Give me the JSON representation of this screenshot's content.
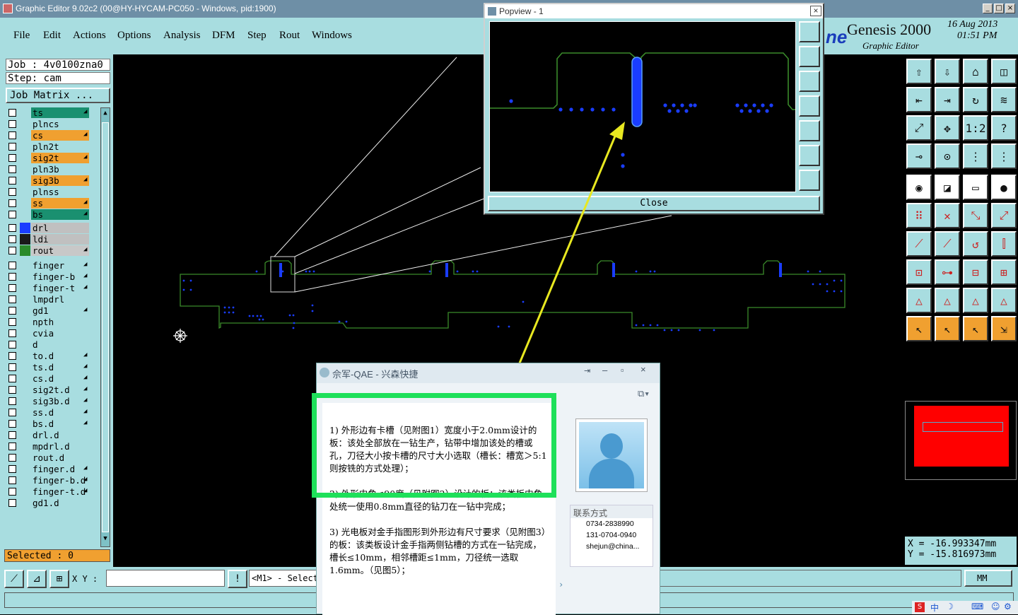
{
  "window": {
    "title": "Graphic Editor 9.02c2 (00@HY-HYCAM-PC050 - Windows, pid:1900)"
  },
  "menu": [
    "File",
    "Edit",
    "Actions",
    "Options",
    "Analysis",
    "DFM",
    "Step",
    "Rout",
    "Windows"
  ],
  "brand": {
    "name": "Genesis 2000",
    "subtitle": "Graphic Editor",
    "date": "16 Aug 2013",
    "time": "01:51 PM"
  },
  "job": {
    "job_label": "Job : 4v0100zna0",
    "step_label": "Step: cam",
    "matrix_button": "Job Matrix ..."
  },
  "layers": [
    {
      "name": "ts",
      "color": "#1a9070",
      "ext": true
    },
    {
      "name": "plncs",
      "color": "#a8dde0",
      "ext": false
    },
    {
      "name": "cs",
      "color": "#f0a030",
      "ext": true
    },
    {
      "name": "pln2t",
      "color": "#a8dde0",
      "ext": false
    },
    {
      "name": "sig2t",
      "color": "#f0a030",
      "ext": true
    },
    {
      "name": "pln3b",
      "color": "#a8dde0",
      "ext": false
    },
    {
      "name": "sig3b",
      "color": "#f0a030",
      "ext": true
    },
    {
      "name": "plnss",
      "color": "#a8dde0",
      "ext": false
    },
    {
      "name": "ss",
      "color": "#f0a030",
      "ext": true
    },
    {
      "name": "bs",
      "color": "#1a9070",
      "ext": true
    },
    {
      "name": "drl",
      "color": "#c0c0c0",
      "ext": false
    },
    {
      "name": "ldi",
      "color": "#c0c0c0",
      "ext": false
    },
    {
      "name": "rout",
      "color": "#c8c8c8",
      "ext": true
    },
    {
      "name": "finger",
      "color": "#a8dde0",
      "ext": true
    },
    {
      "name": "finger-b",
      "color": "#a8dde0",
      "ext": true
    },
    {
      "name": "finger-t",
      "color": "#a8dde0",
      "ext": true
    },
    {
      "name": "lmpdrl",
      "color": "#a8dde0",
      "ext": false
    },
    {
      "name": "gd1",
      "color": "#a8dde0",
      "ext": true
    },
    {
      "name": "npth",
      "color": "#a8dde0",
      "ext": false
    },
    {
      "name": "cvia",
      "color": "#a8dde0",
      "ext": false
    },
    {
      "name": "d",
      "color": "#a8dde0",
      "ext": false
    },
    {
      "name": "to.d",
      "color": "#a8dde0",
      "ext": true
    },
    {
      "name": "ts.d",
      "color": "#a8dde0",
      "ext": true
    },
    {
      "name": "cs.d",
      "color": "#a8dde0",
      "ext": true
    },
    {
      "name": "sig2t.d",
      "color": "#a8dde0",
      "ext": true
    },
    {
      "name": "sig3b.d",
      "color": "#a8dde0",
      "ext": true
    },
    {
      "name": "ss.d",
      "color": "#a8dde0",
      "ext": true
    },
    {
      "name": "bs.d",
      "color": "#a8dde0",
      "ext": true
    },
    {
      "name": "drl.d",
      "color": "#a8dde0",
      "ext": false
    },
    {
      "name": "mpdrl.d",
      "color": "#a8dde0",
      "ext": false
    },
    {
      "name": "rout.d",
      "color": "#a8dde0",
      "ext": false
    },
    {
      "name": "finger.d",
      "color": "#a8dde0",
      "ext": true
    },
    {
      "name": "finger-b.d",
      "color": "#a8dde0",
      "ext": true
    },
    {
      "name": "finger-t.d",
      "color": "#a8dde0",
      "ext": true
    },
    {
      "name": "gd1.d",
      "color": "#a8dde0",
      "ext": false
    }
  ],
  "selected_label": "Selected : 0",
  "bottom": {
    "xy_label": "X Y :",
    "status": "<M1> - Select",
    "units": "MM"
  },
  "coords": {
    "x": "X  = -16.993347mm",
    "y": "Y  = -15.816973mm"
  },
  "popview": {
    "title": "Popview - 1",
    "close": "Close"
  },
  "chat": {
    "title": "佘军-QAE - 兴森快捷",
    "paragraphs": [
      "1) 外形边有卡槽（见附图1）宽度小于2.0mm设计的板：该处全部放在一钻生产，钻带中增加该处的槽或孔，刀径大小按卡槽的尺寸大小选取（槽长：槽宽＞5:1则按铣的方式处理）；",
      "2) 外形内角≤90度（见附图2）设计的板：该类板内角处统一使用0.8mm直径的钻刀在一钻中完成；",
      "3) 光电板对金手指图形到外形边有尺寸要求（见附图3）的板：该类板设计金手指两侧钻槽的方式在一钻完成，槽长≤10mm，相邻槽距≤1mm，刀径统一选取1.6mm。（见图5）；"
    ],
    "contact_header": "联系方式",
    "phone1": "0734-2838990",
    "phone2": "131-0704-0940",
    "email": "shejun@china..."
  },
  "tray": {
    "ime": "中"
  },
  "colors": {
    "panel": "#a8dde0",
    "outline": "#3a8a2a",
    "drill": "#1a3dff",
    "highlight": "#1ee05a",
    "arrow": "#e8e820"
  }
}
